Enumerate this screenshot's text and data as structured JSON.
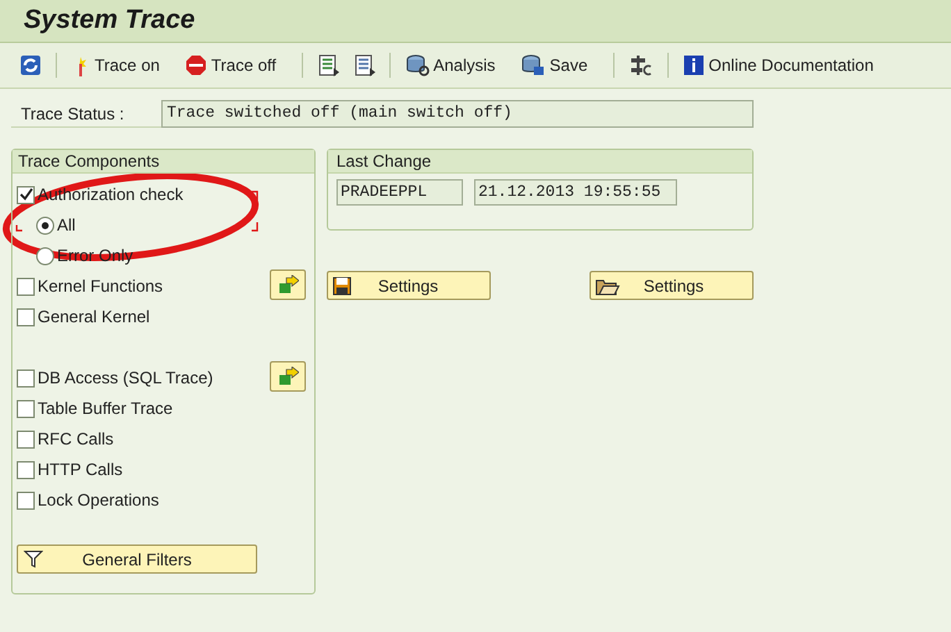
{
  "window": {
    "title": "System Trace"
  },
  "toolbar": [
    {
      "kind": "button"
    },
    {
      "kind": "separator"
    },
    {
      "kind": "button",
      "label": "Trace on"
    },
    {
      "kind": "button",
      "label": "Trace off"
    },
    {
      "kind": "separator"
    },
    {
      "kind": "button"
    },
    {
      "kind": "button"
    },
    {
      "kind": "separator"
    },
    {
      "kind": "button",
      "label": "Analysis"
    },
    {
      "kind": "button",
      "label": "Save"
    },
    {
      "kind": "separator"
    },
    {
      "kind": "button"
    },
    {
      "kind": "separator"
    },
    {
      "kind": "button",
      "label": "Online Documentation"
    }
  ],
  "trace_status": {
    "label": "Trace Status :",
    "value": "Trace switched off (main switch off)"
  },
  "trace_components": {
    "title": "Trace Components",
    "groups": [
      {
        "items": [
          {
            "kind": "checkbox",
            "label": "Authorization check",
            "checked": true,
            "detail_button": false
          },
          {
            "kind": "radio",
            "label": "All",
            "selected": true
          },
          {
            "kind": "radio",
            "label": "Error Only",
            "selected": false
          },
          {
            "kind": "checkbox",
            "label": "Kernel Functions",
            "checked": false,
            "detail_button": true
          },
          {
            "kind": "checkbox",
            "label": "General Kernel",
            "checked": false,
            "detail_button": false
          }
        ]
      },
      {
        "items": [
          {
            "kind": "checkbox",
            "label": "DB Access (SQL Trace)",
            "checked": false,
            "detail_button": true
          },
          {
            "kind": "checkbox",
            "label": "Table Buffer Trace",
            "checked": false,
            "detail_button": false
          },
          {
            "kind": "checkbox",
            "label": "RFC Calls",
            "checked": false,
            "detail_button": false
          },
          {
            "kind": "checkbox",
            "label": "HTTP Calls",
            "checked": false,
            "detail_button": false
          },
          {
            "kind": "checkbox",
            "label": "Lock Operations",
            "checked": false,
            "detail_button": false
          }
        ]
      }
    ],
    "filter_button": "General Filters"
  },
  "last_change": {
    "title": "Last Change",
    "user": "PRADEEPPL",
    "timestamp": "21.12.2013 19:55:55"
  },
  "settings_buttons": [
    "Settings",
    "Settings"
  ]
}
